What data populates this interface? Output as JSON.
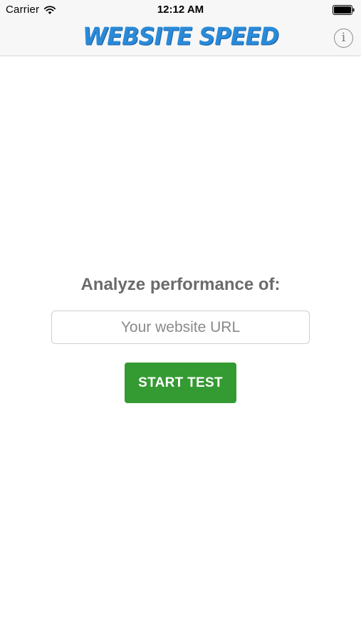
{
  "status_bar": {
    "carrier": "Carrier",
    "time": "12:12 AM",
    "wifi_icon": "wifi-icon",
    "battery_icon": "battery-icon"
  },
  "nav_bar": {
    "title": "WEBSITE SPEED",
    "title_color": "#2a8ad8",
    "info_icon": "info-icon",
    "info_glyph": "i"
  },
  "main": {
    "heading": "Analyze performance of:",
    "url_input": {
      "placeholder": "Your website URL",
      "value": ""
    },
    "start_button": {
      "label": "START TEST",
      "color": "#349a32"
    }
  }
}
